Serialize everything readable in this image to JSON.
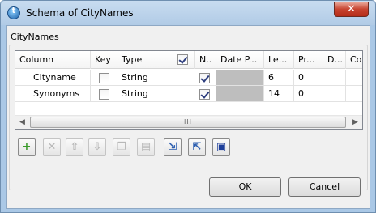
{
  "window": {
    "title": "Schema of CityNames",
    "app_icon_glyph": "t",
    "close_glyph": "✕"
  },
  "section_label": "CityNames",
  "table": {
    "columns": [
      "Column",
      "Key",
      "Type",
      "",
      "N..",
      "Date P...",
      "Le...",
      "Pr...",
      "D...",
      "Co..."
    ],
    "header_checkbox_checked": true,
    "rows": [
      {
        "column": "Cityname",
        "key": false,
        "type": "String",
        "nullable": true,
        "date_pattern": "",
        "length": "6",
        "precision": "0",
        "default": "",
        "comment": ""
      },
      {
        "column": "Synonyms",
        "key": false,
        "type": "String",
        "nullable": true,
        "date_pattern": "",
        "length": "14",
        "precision": "0",
        "default": "",
        "comment": ""
      }
    ],
    "scrollbar": {
      "left_glyph": "◀",
      "right_glyph": "▶",
      "grip_glyph": "III"
    }
  },
  "toolbar": [
    {
      "name": "add-icon",
      "glyph": "+",
      "color": "#3a9a2a",
      "enabled": true
    },
    {
      "name": "remove-icon",
      "glyph": "✕",
      "color": "#b8b8b8",
      "enabled": false
    },
    {
      "name": "move-up-icon",
      "glyph": "⇧",
      "color": "#b8b8b8",
      "enabled": false
    },
    {
      "name": "move-down-icon",
      "glyph": "⇩",
      "color": "#b8b8b8",
      "enabled": false
    },
    {
      "name": "copy-icon",
      "glyph": "❐",
      "color": "#b8b8b8",
      "enabled": false
    },
    {
      "name": "paste-icon",
      "glyph": "▤",
      "color": "#b8b8b8",
      "enabled": false
    },
    {
      "name": "import-icon",
      "glyph": "⇲",
      "color": "#2d5fb0",
      "enabled": true
    },
    {
      "name": "export-icon",
      "glyph": "⇱",
      "color": "#2d5fb0",
      "enabled": true
    },
    {
      "name": "save-icon",
      "glyph": "▣",
      "color": "#1e3f9a",
      "enabled": true
    }
  ],
  "buttons": {
    "ok": "OK",
    "cancel": "Cancel"
  }
}
